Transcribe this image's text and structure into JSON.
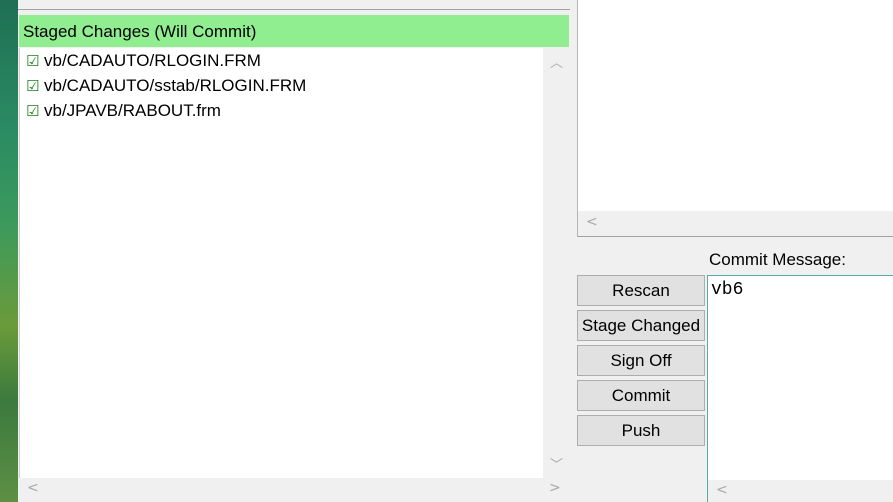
{
  "staged": {
    "header": "Staged Changes (Will Commit)",
    "files": [
      {
        "check": "☑",
        "path": "vb/CADAUTO/RLOGIN.FRM"
      },
      {
        "check": "☑",
        "path": "vb/CADAUTO/sstab/RLOGIN.FRM"
      },
      {
        "check": "☑",
        "path": "vb/JPAVB/RABOUT.frm"
      }
    ],
    "header_color": "#90ee90"
  },
  "actions": {
    "rescan": "Rescan",
    "stage_changed": "Stage Changed",
    "sign_off": "Sign Off",
    "commit": "Commit",
    "push": "Push"
  },
  "commit": {
    "label": "Commit Message:",
    "message": "vb6"
  },
  "scroll_glyphs": {
    "up": "︿",
    "down": "﹀",
    "left": "<",
    "right": ">"
  }
}
